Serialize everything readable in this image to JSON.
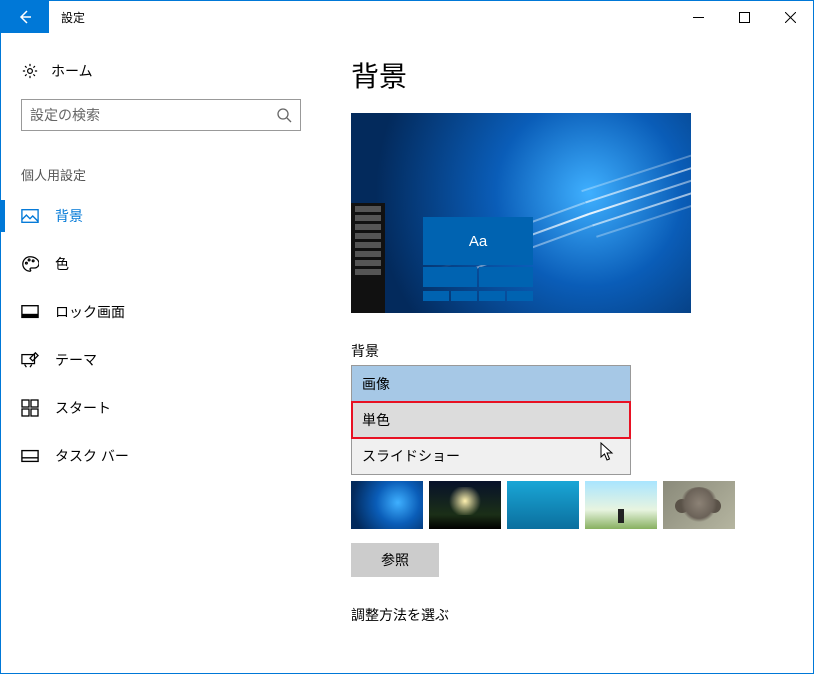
{
  "titlebar": {
    "title": "設定"
  },
  "sidebar": {
    "home": "ホーム",
    "search_placeholder": "設定の検索",
    "category": "個人用設定",
    "items": [
      {
        "label": "背景"
      },
      {
        "label": "色"
      },
      {
        "label": "ロック画面"
      },
      {
        "label": "テーマ"
      },
      {
        "label": "スタート"
      },
      {
        "label": "タスク バー"
      }
    ]
  },
  "main": {
    "page_title": "背景",
    "preview_sample_text": "Aa",
    "bg_field_label": "背景",
    "options": [
      {
        "label": "画像"
      },
      {
        "label": "単色"
      },
      {
        "label": "スライドショー"
      }
    ],
    "browse_label": "参照",
    "fit_label": "調整方法を選ぶ"
  }
}
